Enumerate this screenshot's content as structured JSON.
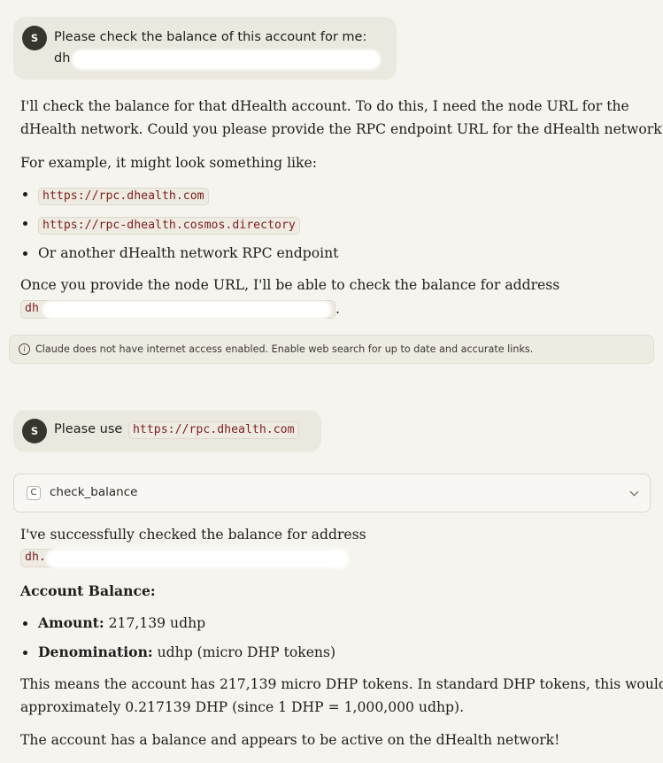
{
  "user_message_1": {
    "avatar": "S",
    "line1": "Please check the balance of this account for me:",
    "line2_prefix": "dh"
  },
  "assistant_message_1": {
    "para1_line1": "I'll check the balance for that dHealth account. To do this, I need the node URL for the",
    "para1_line2": "dHealth network. Could you please provide the RPC endpoint URL for the dHealth network?",
    "para2": "For example, it might look something like:",
    "examples": [
      "https://rpc.dhealth.com",
      "https://rpc-dhealth.cosmos.directory",
      "Or another dHealth network RPC endpoint"
    ],
    "para3": "Once you provide the node URL, I'll be able to check the balance for address",
    "address_prefix": "dh",
    "address_suffix": "."
  },
  "notice": {
    "icon": "info-icon",
    "text": "Claude does not have internet access enabled. Enable web search for up to date and accurate links."
  },
  "user_message_2": {
    "avatar": "S",
    "text": "Please use",
    "url": "https://rpc.dhealth.com"
  },
  "tool_call": {
    "icon_letter": "C",
    "name": "check_balance",
    "icon": "chevron-down-icon"
  },
  "assistant_message_2": {
    "intro": "I've successfully checked the balance for address",
    "address_prefix": "dh.",
    "heading": "Account Balance:",
    "items": [
      {
        "label": "Amount:",
        "value": "217,139 udhp"
      },
      {
        "label": "Denomination:",
        "value": "udhp (micro DHP tokens)"
      }
    ],
    "para1_line1": "This means the account has 217,139 micro DHP tokens. In standard DHP tokens, this would be",
    "para1_line2": "approximately 0.217139 DHP (since 1 DHP = 1,000,000 udhp).",
    "para2": "The account has a balance and appears to be active on the dHealth network!"
  }
}
